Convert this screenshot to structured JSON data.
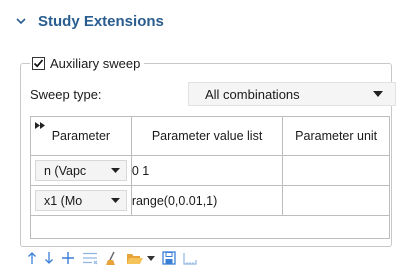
{
  "section": {
    "title": "Study Extensions",
    "icon": "chevron-down-icon"
  },
  "auxiliary_sweep": {
    "label": "Auxiliary sweep",
    "checked": true
  },
  "sweep_type": {
    "label": "Sweep type:",
    "value": "All combinations"
  },
  "table": {
    "columns": [
      "Parameter",
      "Parameter value list",
      "Parameter unit"
    ],
    "rows": [
      {
        "parameter": "n (Vapc",
        "values": "0 1",
        "unit": ""
      },
      {
        "parameter": "x1 (Mo",
        "values": "range(0,0.01,1)",
        "unit": ""
      }
    ]
  },
  "toolbar": {
    "icons": [
      "move-up-icon",
      "move-down-icon",
      "add-icon",
      "list-icon",
      "clear-icon",
      "open-folder-icon",
      "dropdown-icon",
      "save-icon",
      "measure-icon"
    ]
  },
  "colors": {
    "title": "#2a5d8f",
    "accent_blue": "#3a7fd6",
    "folder": "#e8a33a"
  }
}
